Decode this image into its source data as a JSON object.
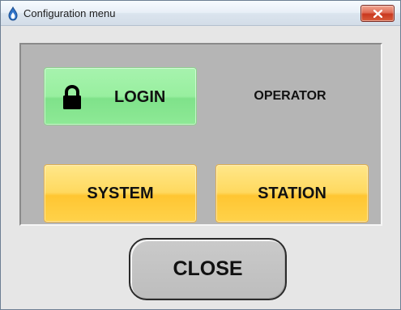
{
  "window": {
    "title": "Configuration menu",
    "app_icon": "flame-icon",
    "close_icon": "close-icon"
  },
  "panel": {
    "login_button": {
      "label": "LOGIN",
      "icon": "lock-icon"
    },
    "operator_label": "OPERATOR",
    "system_button": {
      "label": "SYSTEM"
    },
    "station_button": {
      "label": "STATION"
    }
  },
  "footer": {
    "close_button": {
      "label": "CLOSE"
    }
  },
  "colors": {
    "login_green": "#98ef9f",
    "button_yellow": "#ffd95f",
    "panel_gray": "#b5b5b5",
    "close_gray": "#c4c4c4",
    "titlebar_close_red": "#d85c3c"
  }
}
